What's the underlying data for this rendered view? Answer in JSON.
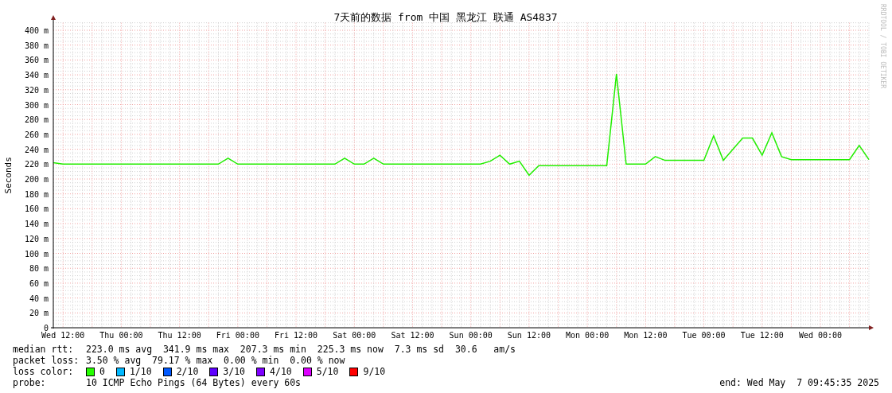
{
  "chart_data": {
    "type": "line",
    "title": "7天前的数据 from 中国 黑龙江 联通 AS4837",
    "ylabel": "Seconds",
    "grid": true,
    "ylim": [
      0,
      410
    ],
    "yticks": [
      {
        "value": 0,
        "label": "0"
      },
      {
        "value": 20,
        "label": "20 m"
      },
      {
        "value": 40,
        "label": "40 m"
      },
      {
        "value": 60,
        "label": "60 m"
      },
      {
        "value": 80,
        "label": "80 m"
      },
      {
        "value": 100,
        "label": "100 m"
      },
      {
        "value": 120,
        "label": "120 m"
      },
      {
        "value": 140,
        "label": "140 m"
      },
      {
        "value": 160,
        "label": "160 m"
      },
      {
        "value": 180,
        "label": "180 m"
      },
      {
        "value": 200,
        "label": "200 m"
      },
      {
        "value": 220,
        "label": "220 m"
      },
      {
        "value": 240,
        "label": "240 m"
      },
      {
        "value": 260,
        "label": "260 m"
      },
      {
        "value": 280,
        "label": "280 m"
      },
      {
        "value": 300,
        "label": "300 m"
      },
      {
        "value": 320,
        "label": "320 m"
      },
      {
        "value": 340,
        "label": "340 m"
      },
      {
        "value": 360,
        "label": "360 m"
      },
      {
        "value": 380,
        "label": "380 m"
      },
      {
        "value": 400,
        "label": "400 m"
      }
    ],
    "categories": [
      null,
      "Wed 12:00",
      null,
      null,
      null,
      null,
      null,
      "Thu 00:00",
      null,
      null,
      null,
      null,
      null,
      "Thu 12:00",
      null,
      null,
      null,
      null,
      null,
      "Fri 00:00",
      null,
      null,
      null,
      null,
      null,
      "Fri 12:00",
      null,
      null,
      null,
      null,
      null,
      "Sat 00:00",
      null,
      null,
      null,
      null,
      null,
      "Sat 12:00",
      null,
      null,
      null,
      null,
      null,
      "Sun 00:00",
      null,
      null,
      null,
      null,
      null,
      "Sun 12:00",
      null,
      null,
      null,
      null,
      null,
      "Mon 00:00",
      null,
      null,
      null,
      null,
      null,
      "Mon 12:00",
      null,
      null,
      null,
      null,
      null,
      "Tue 00:00",
      null,
      null,
      null,
      null,
      null,
      "Tue 12:00",
      null,
      null,
      null,
      null,
      null,
      "Wed 00:00",
      null,
      null,
      null,
      null,
      null
    ],
    "series": [
      {
        "color": "#22ee00",
        "values": [
          222,
          220,
          220,
          220,
          220,
          220,
          220,
          220,
          220,
          220,
          220,
          220,
          220,
          220,
          220,
          220,
          220,
          220,
          228,
          220,
          220,
          220,
          220,
          220,
          220,
          220,
          220,
          220,
          220,
          220,
          228,
          220,
          220,
          228,
          220,
          220,
          220,
          220,
          220,
          220,
          220,
          220,
          220,
          220,
          220,
          224,
          232,
          220,
          224,
          205,
          218,
          218,
          218,
          218,
          218,
          218,
          218,
          218,
          341,
          220,
          220,
          220,
          230,
          225,
          225,
          225,
          225,
          225,
          258,
          225,
          240,
          255,
          255,
          232,
          262,
          230,
          226,
          226,
          226,
          226,
          226,
          226,
          226,
          245,
          226
        ]
      }
    ]
  },
  "credit": "RRDTOOL / TOBI OETIKER",
  "stats": [
    {
      "label": "median rtt:",
      "text": "223.0 ms avg  341.9 ms max  207.3 ms min  225.3 ms now  7.3 ms sd  30.6   am/s"
    },
    {
      "label": "packet loss:",
      "text": "3.50 % avg  79.17 % max  0.00 % min  0.00 % now"
    }
  ],
  "loss_color": {
    "label": "loss color:",
    "items": [
      {
        "label": "0",
        "color": "#26ff00"
      },
      {
        "label": "1/10",
        "color": "#00b8ff"
      },
      {
        "label": "2/10",
        "color": "#0059ff"
      },
      {
        "label": "3/10",
        "color": "#5e00ff"
      },
      {
        "label": "4/10",
        "color": "#7e00ff"
      },
      {
        "label": "5/10",
        "color": "#dd00ff"
      },
      {
        "label": "9/10",
        "color": "#ff0000"
      }
    ]
  },
  "probe": {
    "label": "probe:",
    "text": "10 ICMP Echo Pings (64 Bytes) every 60s",
    "end": "end: Wed May  7 09:45:35 2025"
  }
}
